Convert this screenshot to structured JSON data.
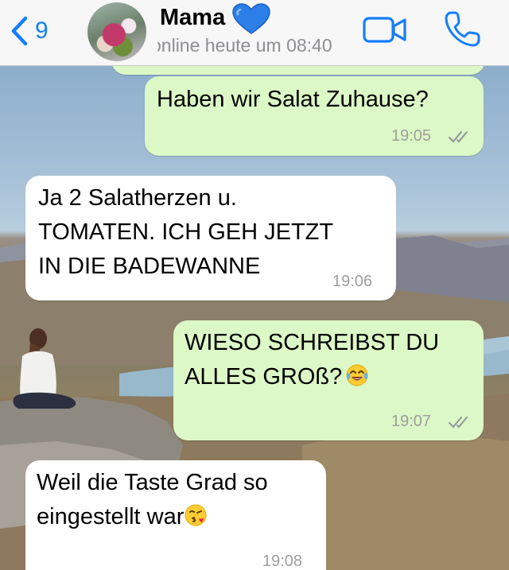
{
  "header": {
    "back_count": "9",
    "contact_name": "Mama",
    "contact_name_emoji": "blue-heart",
    "status": "online heute um 08:40",
    "icons": [
      "chevron-left-icon",
      "video-camera-icon",
      "phone-icon"
    ]
  },
  "colors": {
    "accent": "#147efb",
    "outgoing_bubble": "#dcf8c6",
    "incoming_bubble": "#ffffff",
    "timestamp": "#9e9e9e"
  },
  "messages": [
    {
      "direction": "outgoing",
      "text": "Haben wir Salat Zuhause?",
      "time": "19:05",
      "status": "read"
    },
    {
      "direction": "incoming",
      "text": "Ja 2 Salatherzen u.\nTOMATEN. ICH GEH JETZT\nIN DIE BADEWANNE",
      "time": "19:06"
    },
    {
      "direction": "outgoing",
      "text": "WIESO SCHREIBST DU\nALLES GROß?",
      "emoji": "face-with-tears-of-joy",
      "time": "19:07",
      "status": "read"
    },
    {
      "direction": "incoming",
      "text": "Weil die Taste Grad so\neingestellt war",
      "emoji": "face-throwing-a-kiss",
      "time": "19:08"
    }
  ]
}
